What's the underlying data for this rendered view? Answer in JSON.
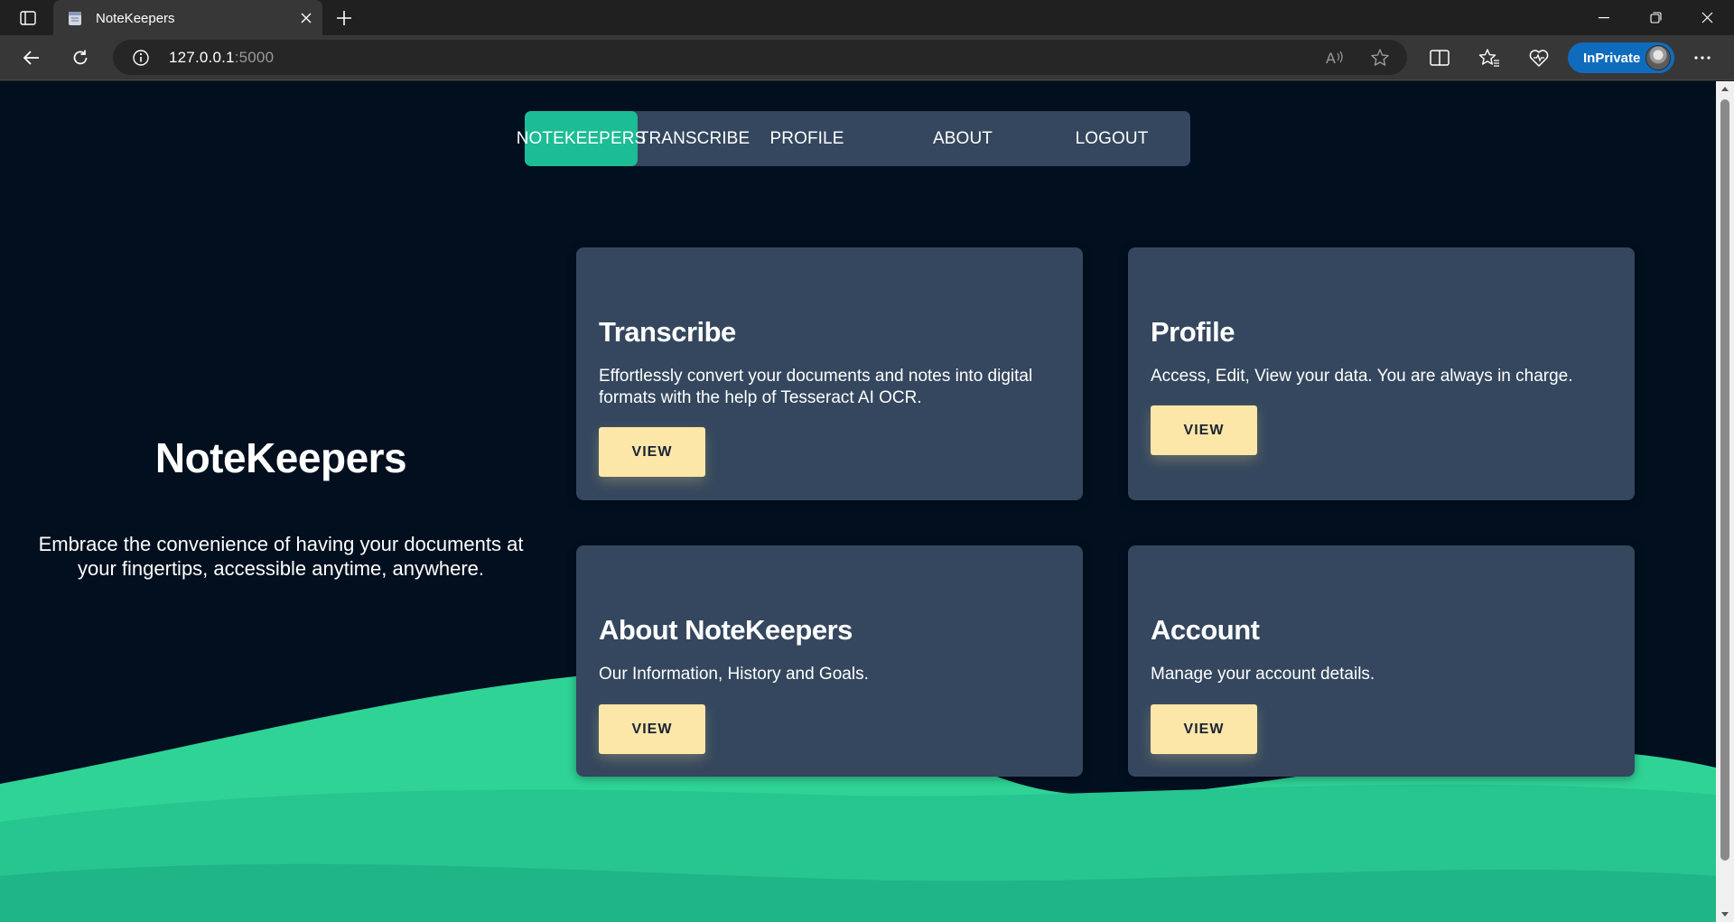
{
  "browser": {
    "tab_title": "NoteKeepers",
    "address_host": "127.0.0.1",
    "address_port": ":5000",
    "inprivate_label": "InPrivate"
  },
  "nav": {
    "items": [
      {
        "label": "NOTEKEEPERS",
        "active": true
      },
      {
        "label": "TRANSCRIBE",
        "active": false
      },
      {
        "label": "PROFILE",
        "active": false
      },
      {
        "label": "ABOUT",
        "active": false
      },
      {
        "label": "LOGOUT",
        "active": false
      }
    ]
  },
  "hero": {
    "title": "NoteKeepers",
    "subtitle": "Embrace the convenience of having your documents at your fingertips, accessible anytime, anywhere."
  },
  "cards": [
    {
      "title": "Transcribe",
      "description": "Effortlessly convert your documents and notes into digital formats with the help of Tesseract AI OCR.",
      "button": "VIEW"
    },
    {
      "title": "Profile",
      "description": "Access, Edit, View your data. You are always in charge.",
      "button": "VIEW"
    },
    {
      "title": "About NoteKeepers",
      "description": "Our Information, History and Goals.",
      "button": "VIEW"
    },
    {
      "title": "Account",
      "description": "Manage your account details.",
      "button": "VIEW"
    }
  ],
  "colors": {
    "page_bg": "#010f1f",
    "card_bg": "#34475e",
    "accent": "#1cbc95",
    "button_bg": "#fde7a8",
    "wave_light": "#2fd396",
    "wave_dark": "#1fb587"
  },
  "icons": [
    "sidebar-toggle-icon",
    "page-favicon-icon",
    "close-icon",
    "plus-icon",
    "minimize-icon",
    "restore-icon",
    "window-close-icon",
    "back-arrow-icon",
    "refresh-icon",
    "info-icon",
    "read-aloud-icon",
    "star-icon",
    "split-screen-icon",
    "favorites-icon",
    "browser-essentials-icon",
    "more-icon"
  ]
}
